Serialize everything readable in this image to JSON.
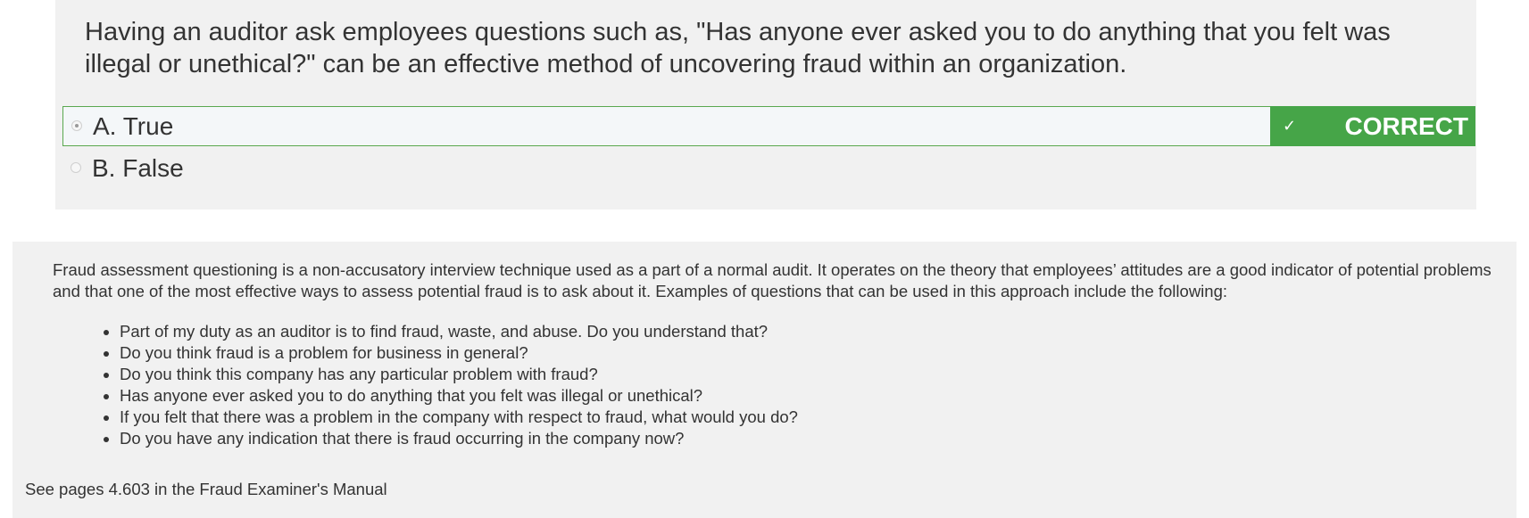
{
  "question": {
    "text": "Having an auditor ask employees questions such as, \"Has anyone ever asked you to do anything that you felt was illegal or unethical?\" can be an effective method of uncovering fraud within an organization."
  },
  "answers": [
    {
      "label": "A. True",
      "selected": true,
      "correct": true
    },
    {
      "label": "B. False",
      "selected": false,
      "correct": false
    }
  ],
  "feedback": {
    "icon": "check-icon",
    "check_glyph": "✓",
    "label": "CORRECT",
    "color": "#46a548"
  },
  "explanation": {
    "intro": "Fraud assessment questioning is a non-accusatory interview technique used as a part of a normal audit. It operates on the theory that employees’ attitudes are a good indicator of potential problems and that one of the most effective ways to assess potential fraud is to ask about it. Examples of questions that can be used in this approach include the following:",
    "bullets": [
      "Part of my duty as an auditor is to find fraud, waste, and abuse. Do you understand that?",
      "Do you think fraud is a problem for business in general?",
      "Do you think this company has any particular problem with fraud?",
      "Has anyone ever asked you to do anything that you felt was illegal or unethical?",
      "If you felt that there was a problem in the company with respect to fraud, what would you do?",
      "Do you have any indication that there is fraud occurring in the company now?"
    ],
    "reference": "See pages 4.603 in the Fraud Examiner's Manual"
  }
}
